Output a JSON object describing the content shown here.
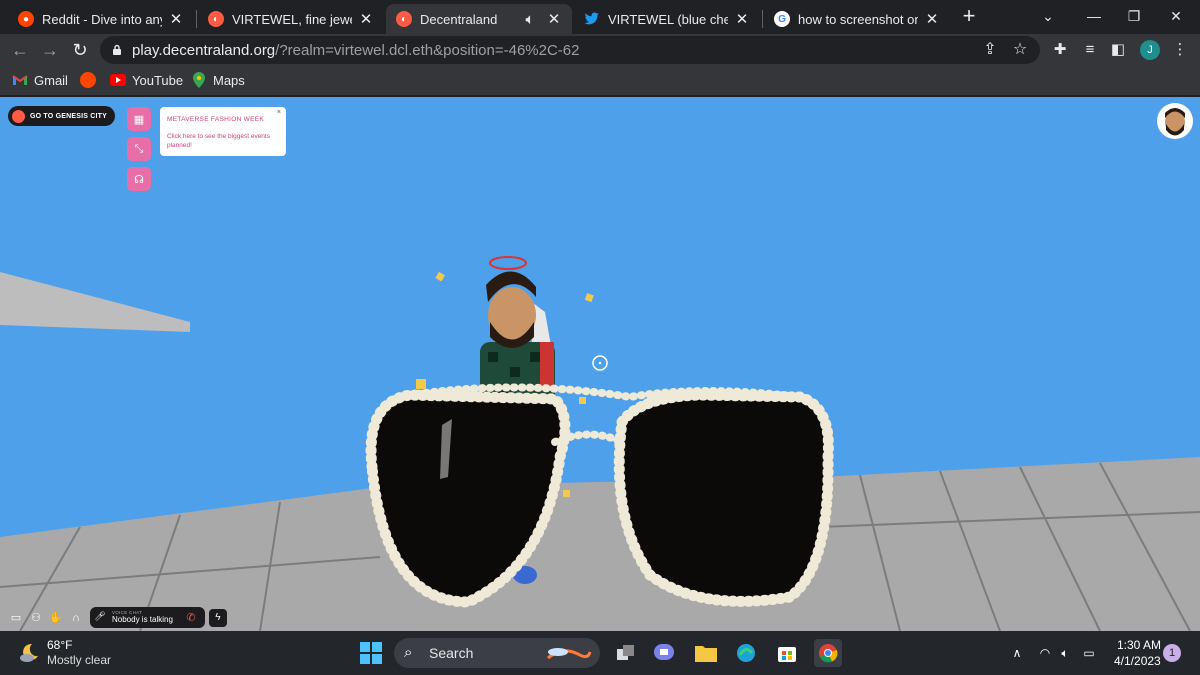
{
  "browser": {
    "tabs": [
      {
        "title": "Reddit - Dive into anything",
        "favicon": "reddit-icon"
      },
      {
        "title": "VIRTEWEL, fine jewelry for",
        "favicon": "decentraland-icon"
      },
      {
        "title": "Decentraland",
        "favicon": "decentraland-icon",
        "active": true,
        "audio": true
      },
      {
        "title": "VIRTEWEL (blue check) (@",
        "favicon": "twitter-icon"
      },
      {
        "title": "how to screenshot on hp",
        "favicon": "google-icon"
      }
    ],
    "url_host": "play.decentraland.org",
    "url_path": "/?realm=virtewel.dcl.eth&position=-46%2C-62",
    "profile_initial": "J",
    "bookmarks": [
      {
        "label": "Gmail",
        "icon": "gmail-icon"
      },
      {
        "label": "",
        "icon": "reddit-icon"
      },
      {
        "label": "YouTube",
        "icon": "youtube-icon"
      },
      {
        "label": "Maps",
        "icon": "maps-icon"
      }
    ]
  },
  "game": {
    "genesis_button": "GO TO GENESIS CITY",
    "event_title": "METAVERSE FASHION WEEK",
    "event_desc": "Click here to see the biggest events planned!",
    "event_close": "×",
    "voice_chat_label": "VOICE CHAT",
    "voice_chat_status": "Nobody is talking",
    "sky_color": "#4ea0ea",
    "accent_pink": "#e86ea8"
  },
  "taskbar": {
    "weather_temp": "68°F",
    "weather_cond": "Mostly clear",
    "search_placeholder": "Search",
    "time": "1:30 AM",
    "date": "4/1/2023",
    "notifications": "1"
  }
}
